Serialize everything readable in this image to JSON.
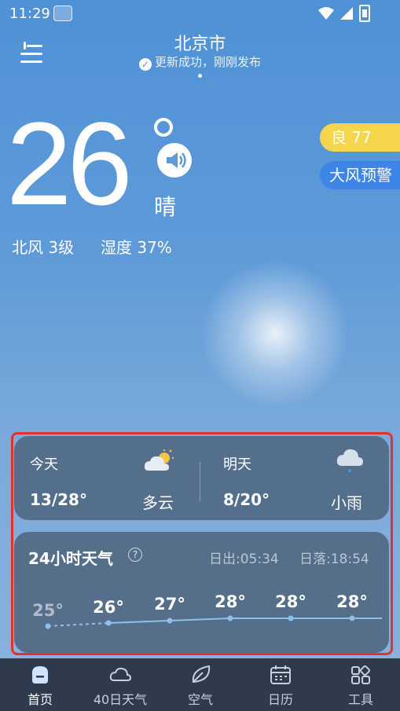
{
  "status_bar": {
    "time": "11:29"
  },
  "header": {
    "city": "北京市",
    "update_status": "更新成功，刚刚发布"
  },
  "current": {
    "temperature": "26",
    "condition": "晴",
    "wind": "北风 3级",
    "humidity": "湿度 37%"
  },
  "badges": {
    "aqi": "良 77",
    "alert": "大风预警"
  },
  "forecast": {
    "today": {
      "label": "今天",
      "range": "13/28°",
      "condition": "多云"
    },
    "tomorrow": {
      "label": "明天",
      "range": "8/20°",
      "condition": "小雨"
    }
  },
  "hourly": {
    "title": "24小时天气",
    "sunrise": "日出:05:34",
    "sunset": "日落:18:54",
    "temps": [
      "25°",
      "26°",
      "27°",
      "28°",
      "28°",
      "28°"
    ]
  },
  "nav": {
    "items": [
      {
        "label": "首页"
      },
      {
        "label": "40日天气"
      },
      {
        "label": "空气"
      },
      {
        "label": "日历"
      },
      {
        "label": "工具"
      }
    ]
  },
  "colors": {
    "aqi_badge": "#f5d54c",
    "alert_badge": "#3d86e8",
    "highlight": "#e0342b",
    "nav_bg": "#2f3b4c"
  }
}
